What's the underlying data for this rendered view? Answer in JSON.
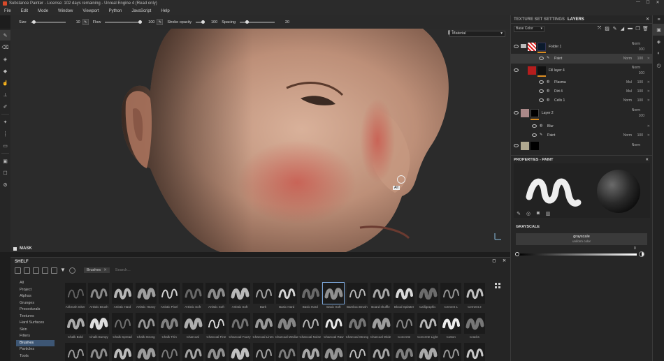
{
  "title": "Substance Painter - License: 102 days remaining - Unreal Engine 4 (Read only)",
  "window_controls": [
    "—",
    "☐",
    "✕"
  ],
  "menu": [
    "File",
    "Edit",
    "Mode",
    "Window",
    "Viewport",
    "Python",
    "JavaScript",
    "Help"
  ],
  "toolbar": {
    "size_label": "Size",
    "size_value": "10",
    "flow_label": "Flow",
    "flow_value": "100",
    "stroke_opacity_label": "Stroke opacity",
    "stroke_opacity_value": "100",
    "spacing_label": "Spacing",
    "spacing_value": "20",
    "size_level": 0.1,
    "flow_level": 1.0,
    "stroke_opacity_level": 1.0,
    "spacing_level": 0.2
  },
  "viewport": {
    "material_select": "Material",
    "alt_label": "Alt",
    "mask_label": "MASK"
  },
  "shelf": {
    "title": "SHELF",
    "filter_chip": "Brushes",
    "search_placeholder": "Search...",
    "categories": [
      "All",
      "Project",
      "Alphas",
      "Grunges",
      "Procedurals",
      "Textures",
      "Hard Surfaces",
      "Skin",
      "Filters",
      "Brushes",
      "Particles",
      "Tools"
    ],
    "active_category": "Brushes",
    "brushes": [
      "Airbrush Inker",
      "Artistic Brush",
      "Artistic Hard",
      "Artistic Heavy",
      "Artistic Pixel",
      "Artistic Soft",
      "Artistic Soft",
      "Artistic Soft",
      "Bark",
      "Basic Hard",
      "Basic Hard",
      "Basic Soft",
      "Bamboo Brush",
      "Board shuffle",
      "Blood Splatter",
      "Calligraphic",
      "Cement 1",
      "Cement 2",
      "Chalk Bold",
      "Chalk Bumpy",
      "Chalk Spread",
      "Chalk Strong",
      "Chalk Thin",
      "Charcoal",
      "Charcoal Fine",
      "Charcoal Fuzzy",
      "Charcoal Lines",
      "Charcoal Medium",
      "Charcoal Noise",
      "Charcoal Raw",
      "Charcoal Strong",
      "Charcoal Wide",
      "Concrete",
      "Concrete Light",
      "Cotton",
      "Cracks",
      "Crystal",
      "Dark Hatcher",
      "Dirt 1",
      "Dirt 2",
      "Dirt 3",
      "Dirt Brushed",
      "Dirt Splash",
      "Dirt Spots",
      "Dirt Spots Dark",
      "Dots",
      "Dots Erased",
      "Dry Mud",
      "Dust",
      "Elephant Skin",
      "Felt Tip Small",
      "Felt Tip Wide",
      "Felt Tip Large",
      "Fibers Dense"
    ],
    "selected_brush": "Basic Soft"
  },
  "panel": {
    "tab1": "TEXTURE SET SETTINGS",
    "tab2": "LAYERS",
    "channel_select": "Base Color",
    "layers": [
      {
        "name": "Folder 1",
        "blend": "Norm",
        "opacity": "100"
      },
      {
        "name": "Paint",
        "blend": "Norm",
        "opacity": "100"
      },
      {
        "name": "Fill layer 4",
        "blend": "Norm",
        "opacity": "100"
      },
      {
        "name": "Plasma",
        "blend": "Mul",
        "opacity": "100"
      },
      {
        "name": "Dirt 4",
        "blend": "Mul",
        "opacity": "100"
      },
      {
        "name": "Cells 1",
        "blend": "Norm",
        "opacity": "100"
      },
      {
        "name": "Layer 2",
        "blend": "Norm",
        "opacity": "100"
      },
      {
        "name": "Blur",
        "blend": "",
        "opacity": ""
      },
      {
        "name": "Paint",
        "blend": "Norm",
        "opacity": "100"
      },
      {
        "name": "",
        "blend": "Norm",
        "opacity": ""
      }
    ],
    "properties_title": "PROPERTIES - PAINT",
    "grayscale_title": "GRAYSCALE",
    "grayscale_name": "grayscale",
    "grayscale_sub": "uniform color",
    "grayscale_value": "0"
  },
  "colors": {
    "accent": "#d98b20",
    "selection": "#3d5674",
    "red_mask": "#b51d1d"
  }
}
